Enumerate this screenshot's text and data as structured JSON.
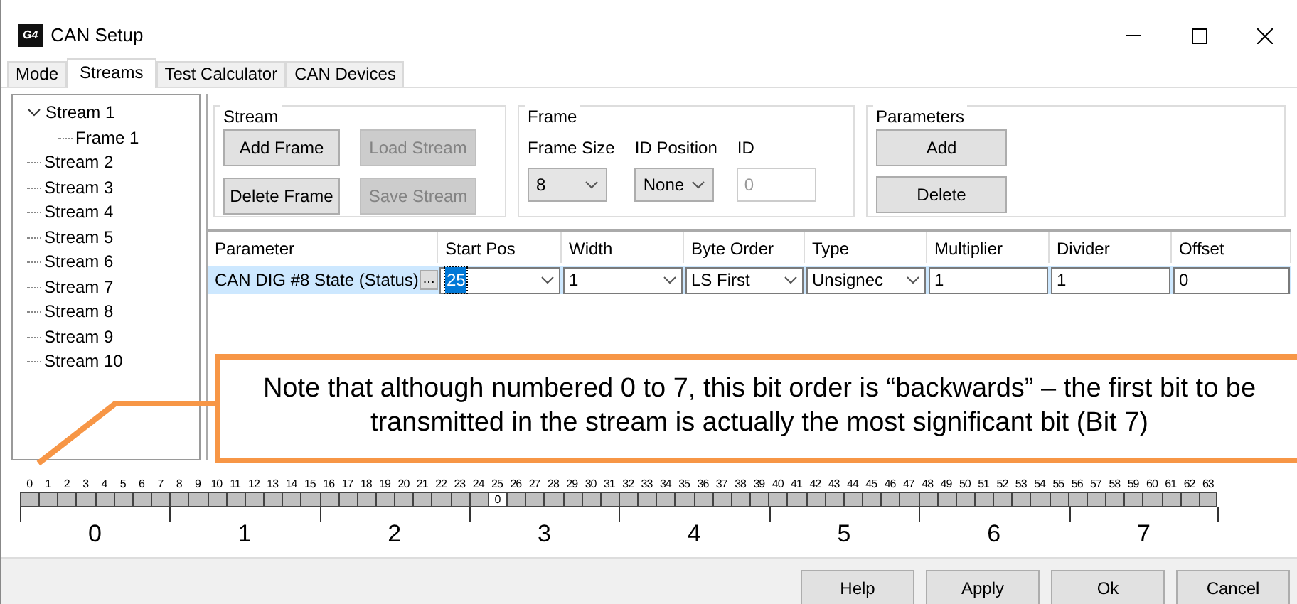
{
  "window": {
    "logo": "G4",
    "title": "CAN Setup"
  },
  "tabs": [
    {
      "label": "Mode",
      "selected": false
    },
    {
      "label": "Streams",
      "selected": true
    },
    {
      "label": "Test Calculator",
      "selected": false
    },
    {
      "label": "CAN Devices",
      "selected": false
    }
  ],
  "tree": [
    {
      "label": "Stream 1",
      "expanded": true,
      "children": [
        {
          "label": "Frame 1"
        }
      ]
    },
    {
      "label": "Stream 2"
    },
    {
      "label": "Stream 3"
    },
    {
      "label": "Stream 4"
    },
    {
      "label": "Stream 5"
    },
    {
      "label": "Stream 6"
    },
    {
      "label": "Stream 7"
    },
    {
      "label": "Stream 8"
    },
    {
      "label": "Stream 9"
    },
    {
      "label": "Stream 10"
    }
  ],
  "stream_group": {
    "title": "Stream",
    "buttons": [
      {
        "label": "Add Frame",
        "disabled": false
      },
      {
        "label": "Load Stream",
        "disabled": true
      },
      {
        "label": "Delete Frame",
        "disabled": false
      },
      {
        "label": "Save Stream",
        "disabled": true
      }
    ]
  },
  "frame_group": {
    "title": "Frame",
    "fields": [
      {
        "label": "Frame Size",
        "kind": "combo",
        "value": "8"
      },
      {
        "label": "ID Position",
        "kind": "combo",
        "value": "None"
      },
      {
        "label": "ID",
        "kind": "input",
        "value": "0",
        "disabled": true
      }
    ]
  },
  "parameters_group": {
    "title": "Parameters",
    "buttons": [
      "Add",
      "Delete"
    ]
  },
  "table": {
    "columns": [
      "Parameter",
      "Start Pos",
      "Width",
      "Byte Order",
      "Type",
      "Multiplier",
      "Divider",
      "Offset"
    ],
    "rows": [
      {
        "selected": true,
        "cells": [
          {
            "kind": "param",
            "value": "CAN DIG #8 State (Status)",
            "button": "..."
          },
          {
            "kind": "combo",
            "value": "25",
            "focused": true
          },
          {
            "kind": "combo",
            "value": "1",
            "focused": false
          },
          {
            "kind": "combo",
            "value": "LS First",
            "focused": false
          },
          {
            "kind": "combo",
            "value": "Unsignec",
            "focused": false
          },
          {
            "kind": "input",
            "value": "1"
          },
          {
            "kind": "input",
            "value": "1"
          },
          {
            "kind": "input",
            "value": "0"
          }
        ]
      }
    ]
  },
  "callout": {
    "text": "Note that although numbered 0 to 7, this bit order is “backwards” – the first bit to be transmitted in the stream is actually the most significant bit (Bit 7)"
  },
  "bits": {
    "cells": [
      {
        "number": "0"
      },
      {
        "number": "1"
      },
      {
        "number": "2"
      },
      {
        "number": "3"
      },
      {
        "number": "4"
      },
      {
        "number": "5"
      },
      {
        "number": "6"
      },
      {
        "number": "7"
      },
      {
        "number": "8"
      },
      {
        "number": "9"
      },
      {
        "number": "10"
      },
      {
        "number": "11"
      },
      {
        "number": "12"
      },
      {
        "number": "13"
      },
      {
        "number": "14"
      },
      {
        "number": "15"
      },
      {
        "number": "16"
      },
      {
        "number": "17"
      },
      {
        "number": "18"
      },
      {
        "number": "19"
      },
      {
        "number": "20"
      },
      {
        "number": "21"
      },
      {
        "number": "22"
      },
      {
        "number": "23"
      },
      {
        "number": "24"
      },
      {
        "number": "25",
        "value": "0"
      },
      {
        "number": "26"
      },
      {
        "number": "27"
      },
      {
        "number": "28"
      },
      {
        "number": "29"
      },
      {
        "number": "30"
      },
      {
        "number": "31"
      },
      {
        "number": "32"
      },
      {
        "number": "33"
      },
      {
        "number": "34"
      },
      {
        "number": "35"
      },
      {
        "number": "36"
      },
      {
        "number": "37"
      },
      {
        "number": "38"
      },
      {
        "number": "39"
      },
      {
        "number": "40"
      },
      {
        "number": "41"
      },
      {
        "number": "42"
      },
      {
        "number": "43"
      },
      {
        "number": "44"
      },
      {
        "number": "45"
      },
      {
        "number": "46"
      },
      {
        "number": "47"
      },
      {
        "number": "48"
      },
      {
        "number": "49"
      },
      {
        "number": "50"
      },
      {
        "number": "51"
      },
      {
        "number": "52"
      },
      {
        "number": "53"
      },
      {
        "number": "54"
      },
      {
        "number": "55"
      },
      {
        "number": "56"
      },
      {
        "number": "57"
      },
      {
        "number": "58"
      },
      {
        "number": "59"
      },
      {
        "number": "60"
      },
      {
        "number": "61"
      },
      {
        "number": "62"
      },
      {
        "number": "63"
      }
    ],
    "bytes": [
      "0",
      "1",
      "2",
      "3",
      "4",
      "5",
      "6",
      "7"
    ]
  },
  "buttons": [
    "Help",
    "Apply",
    "Ok",
    "Cancel"
  ]
}
